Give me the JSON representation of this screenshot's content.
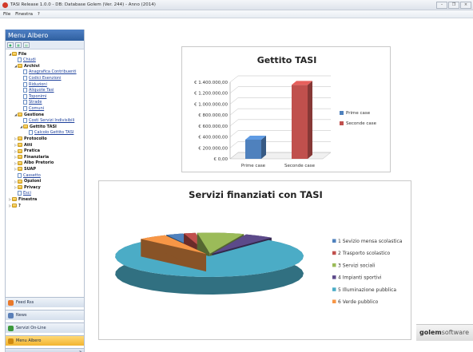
{
  "window": {
    "title": "TASI Release 1.0.0 - DB: Database Golem (Ver. 244) - Anno (2014)",
    "controls": [
      "–",
      "❐",
      "×"
    ]
  },
  "menubar": {
    "items": [
      "File",
      "Finestra",
      "?"
    ]
  },
  "sidebar": {
    "title": "Menu Albero",
    "tree": [
      {
        "label": "File",
        "level": 0,
        "bold": true,
        "kind": "folder",
        "expand": "◢"
      },
      {
        "label": "Chiudi",
        "level": 1,
        "kind": "doc",
        "link": true
      },
      {
        "label": "Archivi",
        "level": 1,
        "bold": true,
        "kind": "folder",
        "expand": "◢"
      },
      {
        "label": "Anagrafica Contribuenti",
        "level": 2,
        "kind": "doc",
        "link": true
      },
      {
        "label": "Codici Esenzioni",
        "level": 2,
        "kind": "doc",
        "link": true
      },
      {
        "label": "Riduzioni",
        "level": 2,
        "kind": "doc",
        "link": true
      },
      {
        "label": "Aliquote Tasi",
        "level": 2,
        "kind": "doc",
        "link": true
      },
      {
        "label": "Toponimi",
        "level": 2,
        "kind": "doc",
        "link": true
      },
      {
        "label": "Strade",
        "level": 2,
        "kind": "doc",
        "link": true
      },
      {
        "label": "Comuni",
        "level": 2,
        "kind": "doc",
        "link": true
      },
      {
        "label": "Gestione",
        "level": 1,
        "bold": true,
        "kind": "folder",
        "expand": "◢"
      },
      {
        "label": "Costi Servizi Indivisibili",
        "level": 2,
        "kind": "doc",
        "link": true
      },
      {
        "label": "Gettito TASI",
        "level": 2,
        "bold": true,
        "kind": "folder",
        "expand": "◢"
      },
      {
        "label": "Calcolo Gettito TASI",
        "level": 3,
        "kind": "doc",
        "link": true
      },
      {
        "label": "Protocollo",
        "level": 1,
        "bold": true,
        "kind": "folder",
        "expand": "▷"
      },
      {
        "label": "Atti",
        "level": 1,
        "bold": true,
        "kind": "folder",
        "expand": "▷"
      },
      {
        "label": "Pratica",
        "level": 1,
        "bold": true,
        "kind": "folder",
        "expand": "▷"
      },
      {
        "label": "Finanziaria",
        "level": 1,
        "bold": true,
        "kind": "folder",
        "expand": "▷"
      },
      {
        "label": "Albo Pretorio",
        "level": 1,
        "bold": true,
        "kind": "folder",
        "expand": "▷"
      },
      {
        "label": "SUAP",
        "level": 1,
        "bold": true,
        "kind": "folder",
        "expand": "▷"
      },
      {
        "label": "Cassetto",
        "level": 1,
        "kind": "doc",
        "link": true
      },
      {
        "label": "Opzioni",
        "level": 1,
        "bold": true,
        "kind": "folder",
        "expand": "▷"
      },
      {
        "label": "Privacy",
        "level": 1,
        "bold": true,
        "kind": "folder",
        "expand": "▷"
      },
      {
        "label": "Esci",
        "level": 1,
        "kind": "doc",
        "link": true
      },
      {
        "label": "Finestra",
        "level": 0,
        "bold": true,
        "kind": "folder",
        "expand": "▷"
      },
      {
        "label": "?",
        "level": 0,
        "bold": true,
        "kind": "folder",
        "expand": "▷"
      }
    ],
    "nav": [
      {
        "label": "Feed Rss",
        "color": "#e8782a",
        "active": false
      },
      {
        "label": "News",
        "color": "#5a7fb8",
        "active": false
      },
      {
        "label": "Servizi On-Line",
        "color": "#3c9a3c",
        "active": false
      },
      {
        "label": "Menu Albero",
        "color": "#d08a10",
        "active": true
      }
    ],
    "collapse_glyph": "»"
  },
  "brand": {
    "left": "golem",
    "right": "software"
  },
  "chart_data": [
    {
      "type": "bar",
      "title": "Gettito TASI",
      "categories": [
        "Prime case",
        "Seconde case"
      ],
      "values": [
        350000,
        1350000
      ],
      "colors": [
        "#4f81bd",
        "#c0504d"
      ],
      "legend": [
        "Prime case",
        "Seconde case"
      ],
      "legend_position": "right",
      "ylim": [
        0,
        1400000
      ],
      "yticks": [
        "€ 0,00",
        "€ 200.000,00",
        "€ 400.000,00",
        "€ 600.000,00",
        "€ 800.000,00",
        "€ 1.000.000,00",
        "€ 1.200.000,00",
        "€ 1.400.000,00"
      ],
      "grid": true
    },
    {
      "type": "pie",
      "title": "Servizi finanziati con TASI",
      "labels": [
        "1 Sevizio mensa scolastica",
        "2 Trasporto scolastico",
        "3 Servizi sociali",
        "4 Impianti sportivi",
        "5 Illuminazione pubblica",
        "6 Verde pubblico"
      ],
      "values": [
        3,
        2,
        8,
        5,
        77,
        5
      ],
      "colors": [
        "#4f81bd",
        "#c0504d",
        "#9bbb59",
        "#5c4a8a",
        "#4bacc6",
        "#f79646"
      ],
      "legend_position": "right"
    }
  ]
}
